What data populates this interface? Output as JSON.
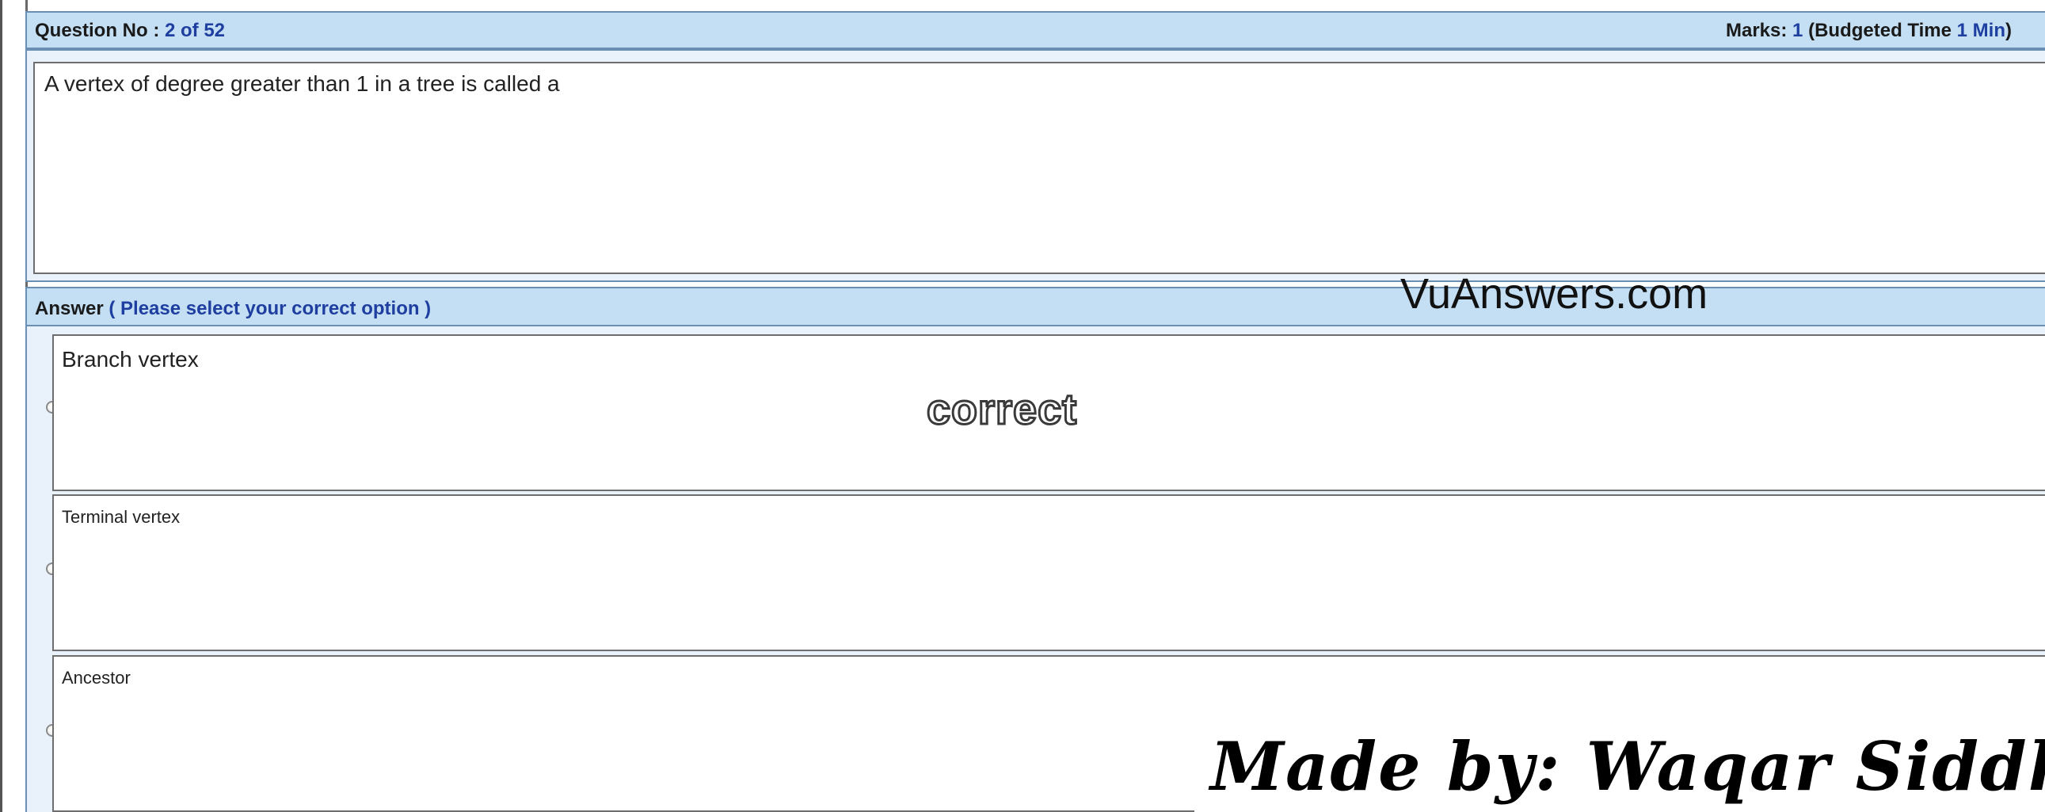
{
  "header": {
    "question_label": "Question No :",
    "question_number": "2 of 52",
    "marks_label": "Marks:",
    "marks_value": "1",
    "budget_label": "(Budgeted Time",
    "budget_value": "1 Min",
    "budget_close": ")"
  },
  "question": {
    "text": "A vertex of degree greater than 1 in a tree is called a"
  },
  "answer_bar": {
    "label": "Answer",
    "hint": "( Please select your correct option )"
  },
  "watermarks": {
    "site": "VuAnswers.com",
    "correct_stamp": "correct",
    "signature": "Made by: Waqar Siddhu"
  },
  "options": [
    {
      "text": "Branch vertex",
      "selected": false
    },
    {
      "text": "Terminal vertex",
      "selected": false
    },
    {
      "text": "Ancestor",
      "selected": false
    }
  ]
}
